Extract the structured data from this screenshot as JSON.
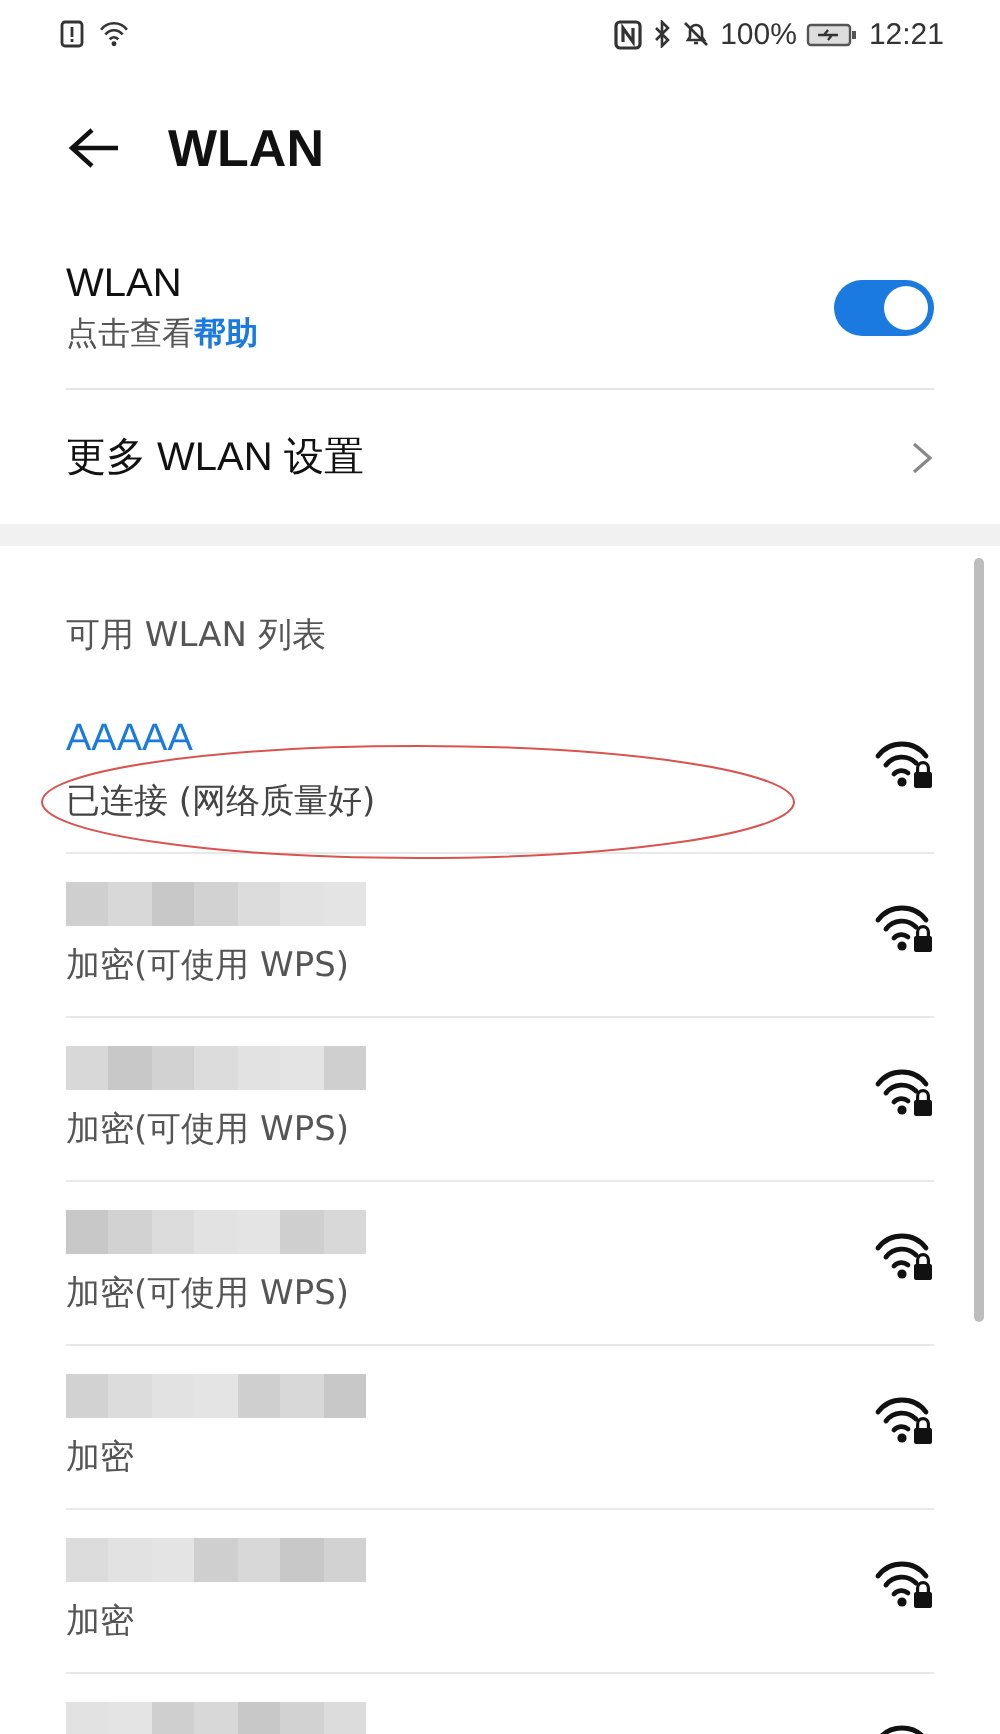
{
  "status_bar": {
    "battery": "100%",
    "time": "12:21"
  },
  "header": {
    "title": "WLAN"
  },
  "wlan_toggle": {
    "label": "WLAN",
    "hint": "点击查看",
    "help_link": "帮助",
    "on": true
  },
  "more_settings": {
    "label": "更多 WLAN 设置"
  },
  "section_title": "可用 WLAN 列表",
  "networks": [
    {
      "name": "AAAAA",
      "status": "已连接 (网络质量好)",
      "connected": true,
      "redacted": false,
      "highlighted": true
    },
    {
      "status": "加密(可使用 WPS)",
      "connected": false,
      "redacted": true,
      "highlighted": false
    },
    {
      "status": "加密(可使用 WPS)",
      "connected": false,
      "redacted": true,
      "highlighted": false
    },
    {
      "status": "加密(可使用 WPS)",
      "connected": false,
      "redacted": true,
      "highlighted": false
    },
    {
      "status": "加密",
      "connected": false,
      "redacted": true,
      "highlighted": false
    },
    {
      "status": "加密",
      "connected": false,
      "redacted": true,
      "highlighted": false
    },
    {
      "connected": false,
      "redacted": true,
      "highlighted": false
    }
  ]
}
